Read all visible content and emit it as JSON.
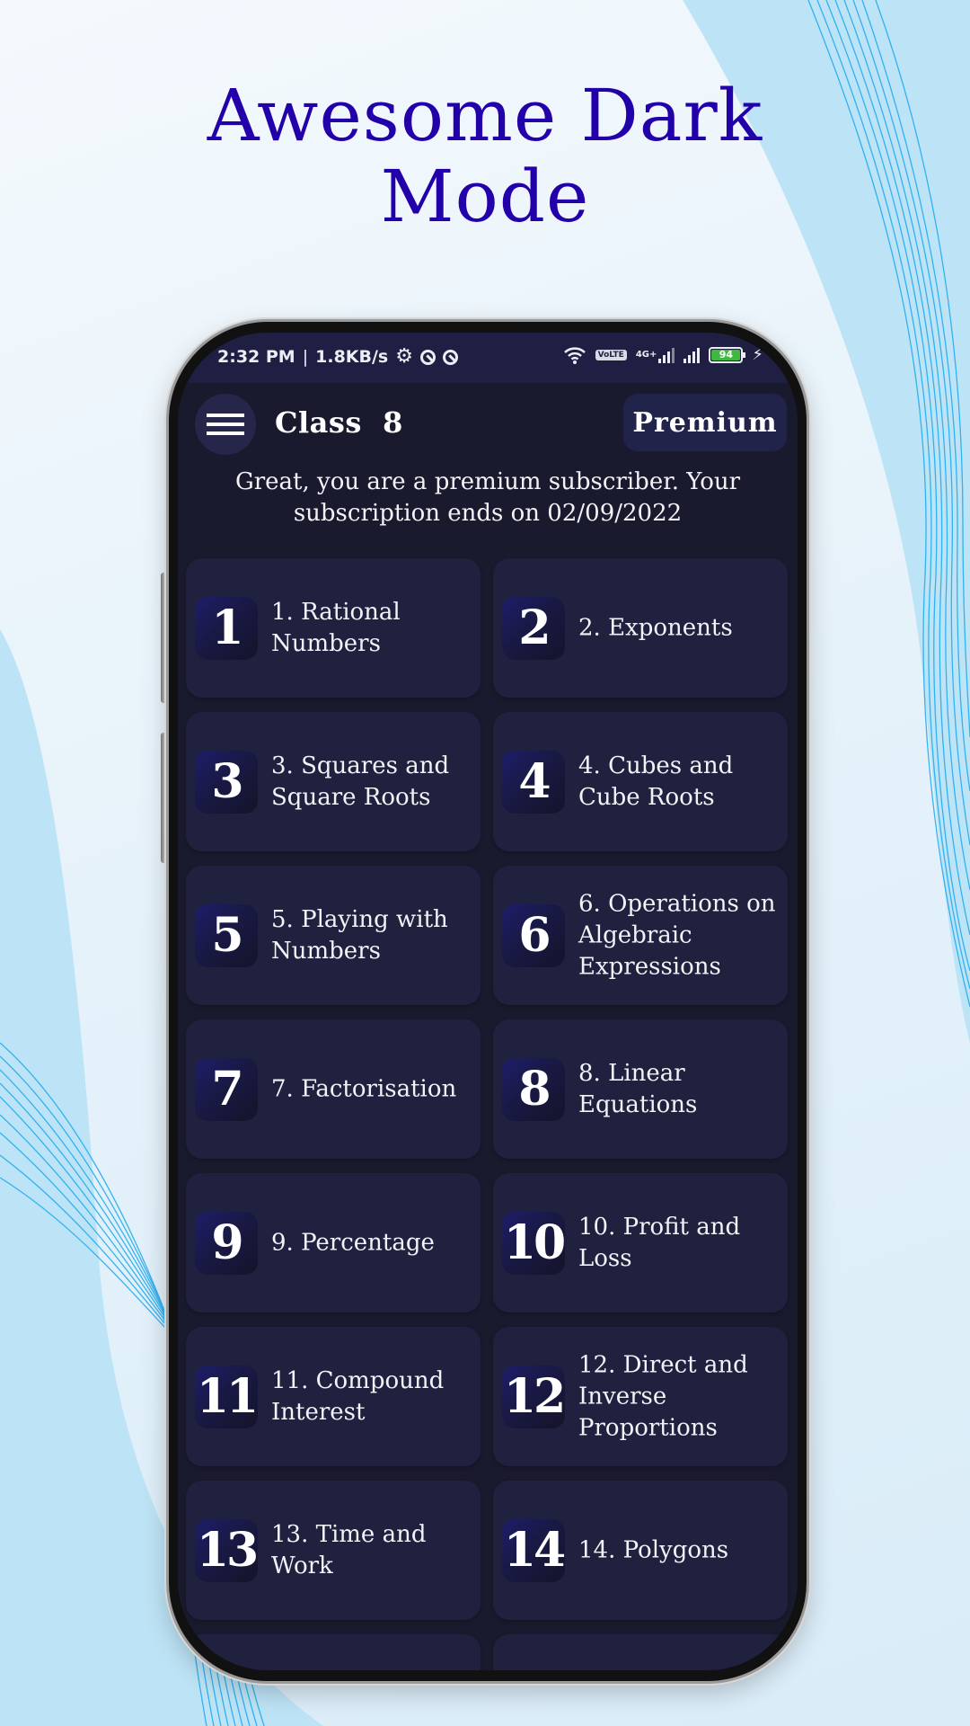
{
  "promo": {
    "title_line1": "Awesome Dark",
    "title_line2": "Mode",
    "title_color": "#2200aa"
  },
  "statusbar": {
    "time": "2:32 PM",
    "separator": "|",
    "speed": "1.8KB/s",
    "left_icons": [
      "gear-icon",
      "sync-icon",
      "sync-icon"
    ],
    "right_icons": [
      "wifi-icon",
      "volte-icon",
      "signal-4g-icon",
      "signal-icon",
      "battery-icon",
      "charging-icon"
    ],
    "volte_text_top": "Vo",
    "volte_text_bottom": "LTE",
    "network_type": "4G+",
    "battery_level": "94"
  },
  "appbar": {
    "menu_icon": "hamburger-icon",
    "title": "Class  8",
    "premium_label": "Premium"
  },
  "subscription_message": "Great, you are a premium subscriber. Your subscription ends on  02/09/2022",
  "colors": {
    "screen_bg": "#1a1a2e",
    "card_bg": "#20213f",
    "statusbar_bg": "#1f1f44",
    "text": "#f2f2f7"
  },
  "chapters": [
    {
      "number": "1",
      "title": "1. Rational Numbers"
    },
    {
      "number": "2",
      "title": "2. Exponents"
    },
    {
      "number": "3",
      "title": "3. Squares and Square Roots"
    },
    {
      "number": "4",
      "title": "4. Cubes and Cube Roots"
    },
    {
      "number": "5",
      "title": "5. Playing with Numbers"
    },
    {
      "number": "6",
      "title": "6. Operations on Algebraic Expressions"
    },
    {
      "number": "7",
      "title": "7. Factorisation"
    },
    {
      "number": "8",
      "title": "8. Linear Equations"
    },
    {
      "number": "9",
      "title": "9. Percentage"
    },
    {
      "number": "10",
      "title": "10. Profit and Loss"
    },
    {
      "number": "11",
      "title": "11. Compound Interest"
    },
    {
      "number": "12",
      "title": "12. Direct and Inverse Proportions"
    },
    {
      "number": "13",
      "title": "13. Time and Work"
    },
    {
      "number": "14",
      "title": "14. Polygons"
    }
  ]
}
